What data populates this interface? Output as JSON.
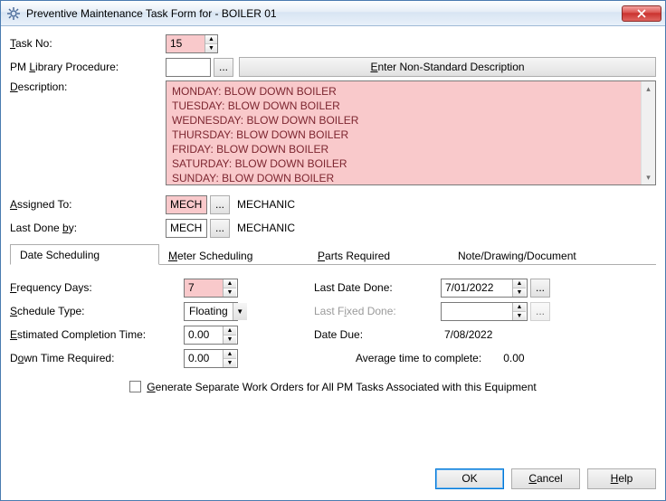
{
  "window": {
    "title": "Preventive Maintenance Task Form for - BOILER 01"
  },
  "labels": {
    "task_no": "Task No:",
    "pm_library": "PM Library Procedure:",
    "description": "Description:",
    "assigned_to": "Assigned To:",
    "last_done_by": "Last Done by:",
    "frequency_days": "Frequency Days:",
    "schedule_type": "Schedule Type:",
    "estimated_completion": "Estimated Completion Time:",
    "down_time": "Down Time Required:",
    "last_date_done": "Last Date Done:",
    "last_fixed_done": "Last Fixed Done:",
    "date_due": "Date Due:",
    "avg_time": "Average time to complete:"
  },
  "values": {
    "task_no": "15",
    "pm_library": "",
    "description": "MONDAY: BLOW DOWN BOILER\nTUESDAY: BLOW DOWN BOILER\nWEDNESDAY: BLOW DOWN BOILER\nTHURSDAY: BLOW DOWN BOILER\nFRIDAY: BLOW DOWN BOILER\nSATURDAY: BLOW DOWN BOILER\nSUNDAY: BLOW DOWN BOILER",
    "assigned_to_code": "MECH",
    "assigned_to_name": "MECHANIC",
    "last_done_by_code": "MECH",
    "last_done_by_name": "MECHANIC",
    "frequency_days": "7",
    "schedule_type": "Floating",
    "estimated_completion": "0.00",
    "down_time": "0.00",
    "last_date_done": "7/01/2022",
    "last_fixed_done": "",
    "date_due": "7/08/2022",
    "avg_time": "0.00"
  },
  "buttons": {
    "enter_nonstd": "Enter Non-Standard Description",
    "ok": "OK",
    "cancel": "Cancel",
    "help": "Help",
    "ellipsis": "..."
  },
  "tabs": {
    "date_scheduling": "Date Scheduling",
    "meter_scheduling": "Meter Scheduling",
    "parts_required": "Parts Required",
    "note": "Note/Drawing/Document"
  },
  "checkbox": {
    "generate_separate": "Generate Separate Work Orders for All PM Tasks Associated with this Equipment"
  }
}
